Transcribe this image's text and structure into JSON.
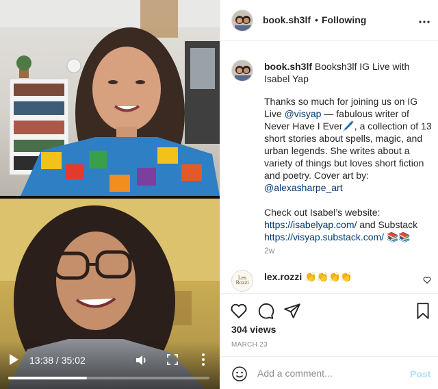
{
  "video": {
    "time_text": "13:38 / 35:02",
    "progress_fraction": 0.39,
    "icons": {
      "play": "play-icon",
      "volume": "volume-icon",
      "fullscreen": "fullscreen-icon",
      "more": "more-vertical-icon"
    }
  },
  "header": {
    "username": "book.sh3lf",
    "separator": "•",
    "follow_label": "Following",
    "more_icon": "more-horizontal-icon"
  },
  "caption": {
    "username": "book.sh3lf",
    "title": "Booksh3lf IG Live with Isabel Yap",
    "p1": {
      "t1": "Thanks so much for joining us on IG Live ",
      "mention1": "@visyap",
      "t2": " — fabulous writer of Never Have I Ever🖊️, a collection of 13 short stories about spells, magic, and urban legends. She writes about a variety of things but loves short fiction and poetry. Cover art by:",
      "mention2": "@alexasharpe_art"
    },
    "p2": {
      "t1": "Check out Isabel’s website:",
      "link1": "https://isabelyap.com/",
      "t2": " and Substack",
      "link2": "https://visyap.substack.com/",
      "t3": " 📚📚"
    },
    "age": "2w"
  },
  "comment": {
    "avatar_text": "Les Rozzi",
    "username": "lex.rozzi",
    "text": "👏👏👏👏"
  },
  "actions": {
    "views": "304 views",
    "date": "MARCH 23"
  },
  "add_comment": {
    "placeholder": "Add a comment...",
    "post_label": "Post"
  },
  "colors": {
    "link": "#00376b",
    "post_button": "#b2dffc",
    "muted": "#8e8e8e"
  }
}
